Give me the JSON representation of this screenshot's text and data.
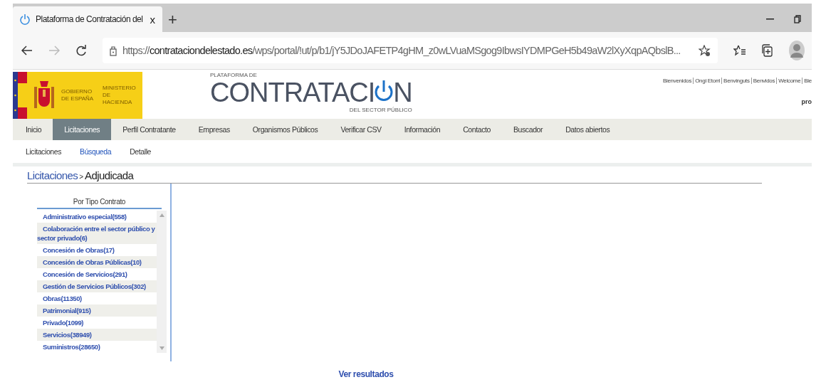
{
  "browser": {
    "tab_title": "Plataforma de Contratación del",
    "tab_close": "x",
    "new_tab": "+",
    "url": {
      "scheme": "https://",
      "host": "contrataciondelestado.es",
      "path": "/wps/portal/!ut/p/b1/jY5JDoJAFETP4gHM_z0wLVuaMSgog9IbwsIYDMPGeH5b49aW2lXyXqpAQbslB..."
    }
  },
  "header": {
    "government": "GOBIERNO DE ESPAÑA",
    "ministry": "MINISTERIO DE HACIENDA",
    "logo_top": "PLATAFORMA DE",
    "logo_main_left": "CONTRATACI",
    "logo_main_right": "N",
    "logo_bottom": "DEL SECTOR PÚBLICO",
    "languages": [
      "Bienvenidos",
      "Ongi Etorri",
      "Benvinguts",
      "Benvidos",
      "Welcome",
      "Bie"
    ],
    "user_text": "pro"
  },
  "nav": [
    {
      "label": "Inicio",
      "selected": false
    },
    {
      "label": "Licitaciones",
      "selected": true
    },
    {
      "label": "Perfil Contratante",
      "selected": false
    },
    {
      "label": "Empresas",
      "selected": false
    },
    {
      "label": "Organismos Públicos",
      "selected": false
    },
    {
      "label": "Verificar CSV",
      "selected": false
    },
    {
      "label": "Información",
      "selected": false
    },
    {
      "label": "Contacto",
      "selected": false
    },
    {
      "label": "Buscador",
      "selected": false
    },
    {
      "label": "Datos abiertos",
      "selected": false
    }
  ],
  "subnav": [
    {
      "label": "Licitaciones",
      "selected": false
    },
    {
      "label": "Búsqueda",
      "selected": true
    },
    {
      "label": "Detalle",
      "selected": false
    }
  ],
  "breadcrumb": {
    "link": "Licitaciones",
    "separator": ">",
    "current": "Adjudicada"
  },
  "filter": {
    "title": "Por Tipo Contrato",
    "items": [
      "Administrativo especial(558)",
      "Colaboración entre el sector público y sector privado(6)",
      "Concesión de Obras(17)",
      "Concesión de Obras Públicas(10)",
      "Concesión de Servicios(291)",
      "Gestión de Servicios Públicos(302)",
      "Obras(11350)",
      "Patrimonial(915)",
      "Privado(1099)",
      "Servicios(38949)",
      "Suministros(28650)"
    ]
  },
  "results_link": "Ver resultados"
}
